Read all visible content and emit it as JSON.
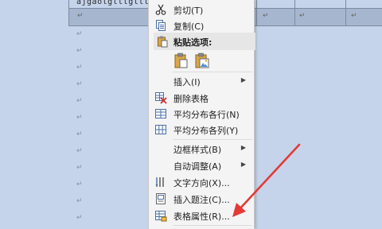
{
  "document": {
    "row1_text": "ajgaolglllglllj",
    "cell_mark": "↵",
    "paragraph_mark": "↵"
  },
  "menu": {
    "items": [
      {
        "label": "剪切(T)",
        "icon": "scissors-icon"
      },
      {
        "label": "复制(C)",
        "icon": "copy-icon"
      },
      {
        "label": "粘贴选项:",
        "icon": "paste-icon"
      },
      {
        "label": "插入(I)",
        "icon": "",
        "submenu": true
      },
      {
        "label": "删除表格",
        "icon": "delete-table-icon"
      },
      {
        "label": "平均分布各行(N)",
        "icon": "distribute-rows-icon"
      },
      {
        "label": "平均分布各列(Y)",
        "icon": "distribute-columns-icon"
      },
      {
        "label": "边框样式(B)",
        "icon": "",
        "submenu": true
      },
      {
        "label": "自动调整(A)",
        "icon": "",
        "submenu": true
      },
      {
        "label": "文字方向(X)...",
        "icon": "text-direction-icon"
      },
      {
        "label": "插入题注(C)...",
        "icon": "insert-caption-icon"
      },
      {
        "label": "表格属性(R)...",
        "icon": "table-properties-icon"
      }
    ],
    "submenu_arrow": "▶"
  },
  "annotation": {
    "color": "#e53935"
  }
}
